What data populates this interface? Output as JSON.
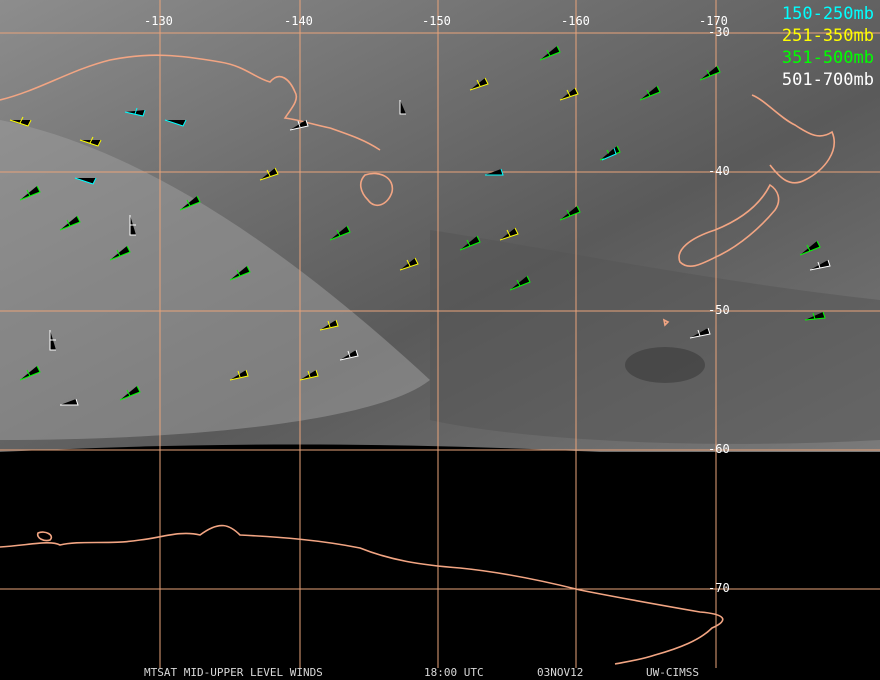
{
  "grid": {
    "longitudes": [
      "-130",
      "-140",
      "-150",
      "-160",
      "-170"
    ],
    "latitudes": [
      "-30",
      "-40",
      "-50",
      "-60",
      "-70"
    ]
  },
  "legend": [
    {
      "label": "150-250mb",
      "color": "#00ffff"
    },
    {
      "label": "251-350mb",
      "color": "#ffff00"
    },
    {
      "label": "351-500mb",
      "color": "#00ff00"
    },
    {
      "label": "501-700mb",
      "color": "#ffffff"
    }
  ],
  "caption": {
    "product": "MTSAT MID-UPPER LEVEL WINDS",
    "time": "18:00 UTC",
    "date": "03NOV12",
    "source": "UW-CIMSS"
  },
  "colors": {
    "grid": "#e8a37a",
    "coastline": "#f2a583",
    "imagery_light": "#9a9a9a",
    "imagery_dark": "#2a2a2a",
    "space": "#000000"
  }
}
